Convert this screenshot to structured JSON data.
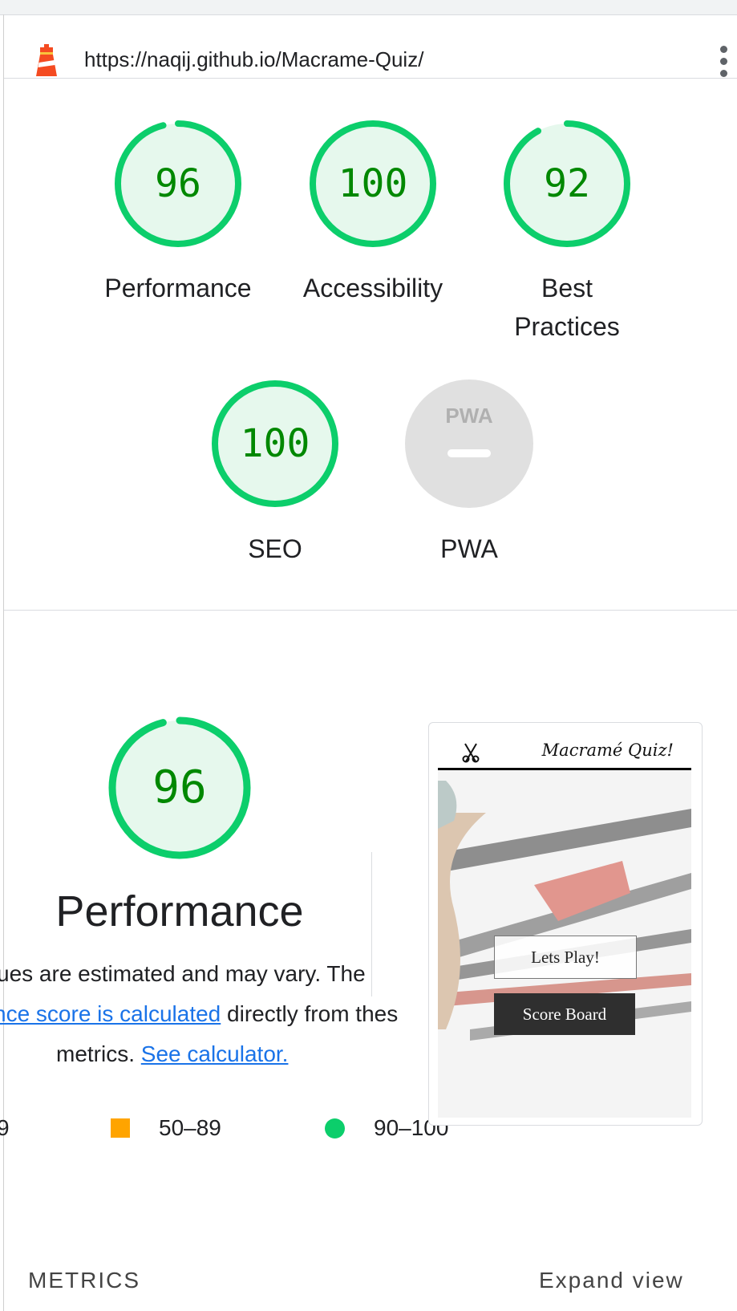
{
  "browser": {
    "url": "https://naqij.github.io/Macrame-Quiz/",
    "lighthouse_icon": "lighthouse-icon",
    "menu_icon": "kebab-menu-icon"
  },
  "colors": {
    "pass": "#0cce6b",
    "pass_fill": "#e6f8ed",
    "pass_text": "#008800",
    "average": "#ffa400",
    "na": "#e0e0e0",
    "link": "#1a73e8"
  },
  "scores": [
    {
      "score": 96,
      "label": "Performance"
    },
    {
      "score": 100,
      "label": "Accessibility"
    },
    {
      "score": 92,
      "label": "Best Practices",
      "label_line1": "Best",
      "label_line2": "Practices"
    },
    {
      "score": 100,
      "label": "SEO"
    }
  ],
  "pwa": {
    "label": "PWA",
    "badge_text": "PWA",
    "badge_icon": "pwa-badge-icon"
  },
  "performance": {
    "score": 96,
    "title": "Performance",
    "desc_line1": "ues are estimated and may vary. The",
    "desc_link1": "nce score is calculated",
    "desc_line2_rest": " directly from thes",
    "desc_line3": "metrics.",
    "desc_link2": "See calculator."
  },
  "legend": {
    "fail": "9",
    "average": "50–89",
    "pass": "90–100"
  },
  "screenshot": {
    "site_title": "Macramé Quiz!",
    "site_icon": "scissors-icon",
    "button_play": "Lets Play!",
    "button_score": "Score Board"
  },
  "metrics": {
    "heading": "METRICS",
    "expand_label": "Expand view"
  }
}
